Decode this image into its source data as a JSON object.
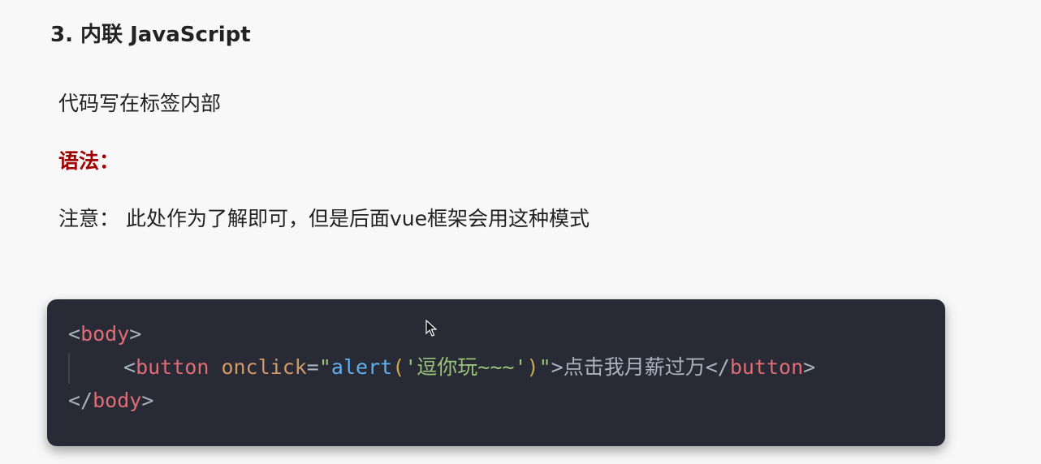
{
  "section": {
    "heading": "3. 内联 JavaScript",
    "intro": "代码写在标签内部",
    "syntax_label": "语法：",
    "note": "注意： 此处作为了解即可，但是后面vue框架会用这种模式"
  },
  "code": {
    "line1": {
      "open_bracket": "<",
      "tag": "body",
      "close_bracket": ">"
    },
    "line2": {
      "open_bracket": "<",
      "tag": "button",
      "space": " ",
      "attr": "onclick",
      "equals": "=",
      "quote_open": "\"",
      "fn": "alert",
      "paren_open": "(",
      "string": "'逗你玩~~~'",
      "paren_close": ")",
      "quote_close": "\"",
      "gt": ">",
      "text": "点击我月薪过万",
      "close_open_bracket": "</",
      "close_tag": "button",
      "close_gt": ">"
    },
    "line3": {
      "open_bracket": "</",
      "tag": "body",
      "close_bracket": ">"
    }
  },
  "colors": {
    "tag": "#e06c75",
    "attribute": "#d19a66",
    "function": "#61afef",
    "string": "#98c379",
    "code_background": "#282b35",
    "syntax_label": "#a00000"
  },
  "icons": {
    "cursor": "mouse-pointer-icon"
  }
}
